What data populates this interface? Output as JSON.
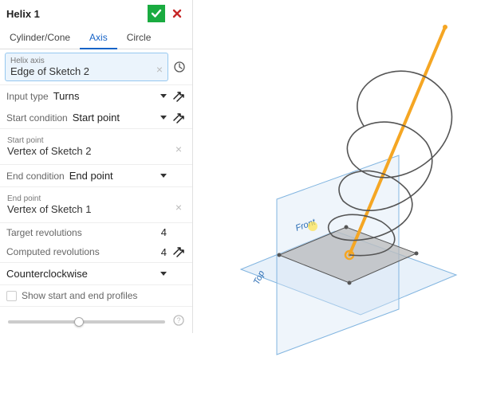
{
  "header": {
    "title": "Helix 1"
  },
  "tabs": [
    "Cylinder/Cone",
    "Axis",
    "Circle"
  ],
  "active_tab": 1,
  "helix_axis": {
    "label": "Helix axis",
    "value": "Edge of Sketch 2"
  },
  "input_type": {
    "label": "Input type",
    "value": "Turns"
  },
  "start_condition": {
    "label": "Start condition",
    "value": "Start point"
  },
  "start_point": {
    "label": "Start point",
    "value": "Vertex of Sketch 2"
  },
  "end_condition": {
    "label": "End condition",
    "value": "End point"
  },
  "end_point": {
    "label": "End point",
    "value": "Vertex of Sketch 1"
  },
  "target_revolutions": {
    "label": "Target revolutions",
    "value": "4"
  },
  "computed_revolutions": {
    "label": "Computed revolutions",
    "value": "4"
  },
  "direction": {
    "value": "Counterclockwise"
  },
  "show_profiles": {
    "label": "Show start and end profiles"
  },
  "viewport": {
    "front_label": "Front",
    "top_label": "Top"
  }
}
